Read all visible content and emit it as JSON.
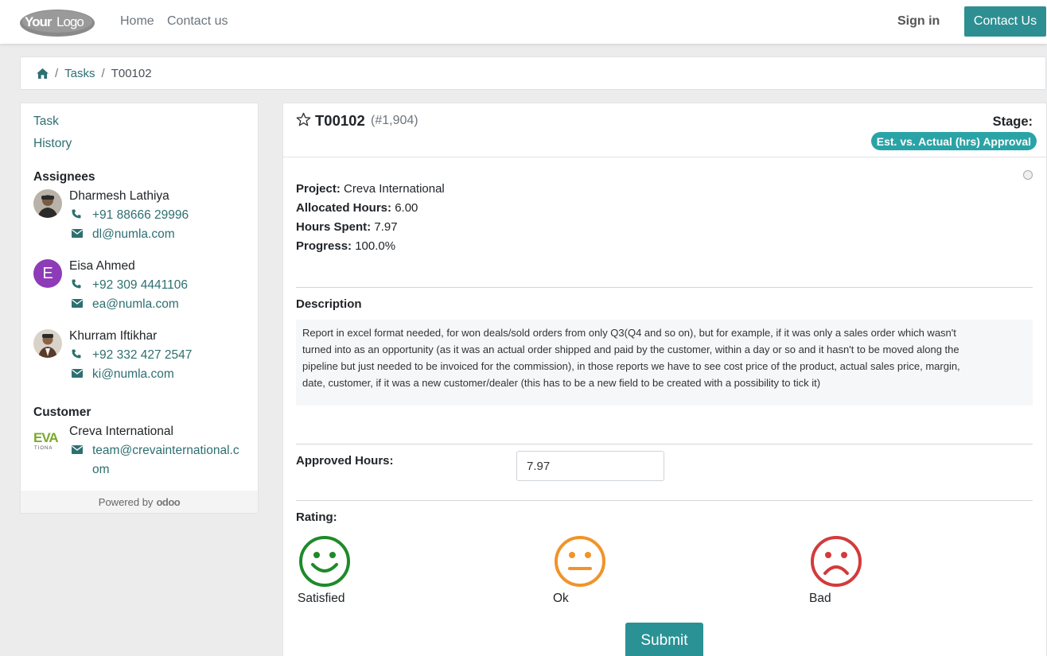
{
  "header": {
    "logo_text": "YourLogo",
    "nav": [
      "Home",
      "Contact us"
    ],
    "sign_in": "Sign in",
    "contact_button": "Contact Us"
  },
  "breadcrumb": {
    "home_icon": "home-icon",
    "items": [
      "Tasks",
      "T00102"
    ],
    "separator": "/"
  },
  "sidebar": {
    "links": [
      "Task",
      "History"
    ],
    "assignees_heading": "Assignees",
    "assignees": [
      {
        "name": "Dharmesh Lathiya",
        "phone": "+91 88666 29996",
        "email": "dl@numla.com",
        "avatar": "photo"
      },
      {
        "name": "Eisa Ahmed",
        "phone": "+92 309 4441106",
        "email": "ea@numla.com",
        "avatar": "initial",
        "initial": "E",
        "avatar_color": "#8e3bb8"
      },
      {
        "name": "Khurram Iftikhar",
        "phone": "+92 332 427 2547",
        "email": "ki@numla.com",
        "avatar": "photo"
      }
    ],
    "customer_heading": "Customer",
    "customer": {
      "name": "Creva International",
      "email_line1": "team@crevainternational.c",
      "email_line2": "om",
      "logo_text": "EVA",
      "logo_subtext": "TIONA"
    },
    "powered_by": "Powered by",
    "powered_brand": "odoo"
  },
  "task": {
    "title": "T00102",
    "number": "(#1,904)",
    "stage_label": "Stage:",
    "stage_value": "Est. vs. Actual (hrs) Approval",
    "fields": [
      {
        "label": "Project:",
        "value": "Creva International"
      },
      {
        "label": "Allocated Hours:",
        "value": "6.00"
      },
      {
        "label": "Hours Spent:",
        "value": "7.97"
      },
      {
        "label": "Progress:",
        "value": "100.0%"
      }
    ],
    "description_heading": "Description",
    "description_lines": [
      "Report in excel format needed, for won deals/sold orders from only Q3(Q4 and so on), but for example, if it was only a sales order which wasn't",
      "turned into as an opportunity (as it was an actual order shipped and paid by the customer, within a day or so and it hasn't to be moved along the",
      "pipeline but just needed to be invoiced for the commission), in those reports we have to see cost price of the product, actual sales price, margin,",
      "date, customer, if it was a new customer/dealer (this has to be a new field to be created with a possibility to tick it)"
    ],
    "approved_hours_label": "Approved Hours:",
    "approved_hours_value": "7.97",
    "rating_label": "Rating:",
    "ratings": [
      {
        "label": "Satisfied",
        "color": "#1e8a2a",
        "icon": "smile-icon"
      },
      {
        "label": "Ok",
        "color": "#f0942a",
        "icon": "neutral-face-icon"
      },
      {
        "label": "Bad",
        "color": "#d23b3b",
        "icon": "frown-icon"
      }
    ],
    "submit_label": "Submit"
  },
  "colors": {
    "accent": "#2e8f92",
    "link": "#2e6f71",
    "badge": "#2aa3a6"
  }
}
